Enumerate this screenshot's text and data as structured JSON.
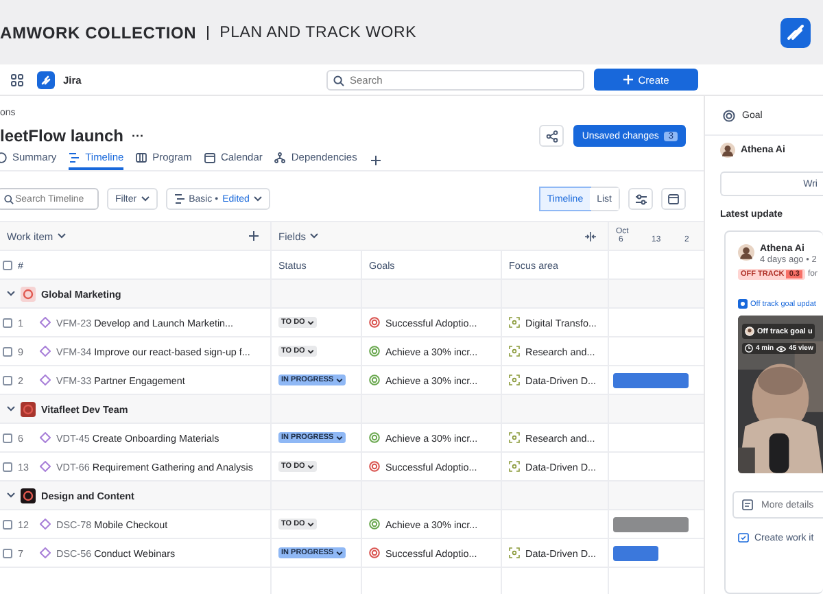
{
  "banner": {
    "title": "AMWORK COLLECTION",
    "subtitle": "PLAN AND TRACK WORK"
  },
  "nav": {
    "app": "Jira",
    "search": {
      "placeholder": "Search"
    },
    "create": "Create"
  },
  "breadcrumb": "ons",
  "title": "leetFlow launch",
  "more": "···",
  "unsaved": {
    "label": "Unsaved changes",
    "count": "3"
  },
  "tabs": [
    {
      "label": "Summary",
      "kind": "summary",
      "selected": false
    },
    {
      "label": "Timeline",
      "kind": "timeline",
      "selected": true
    },
    {
      "label": "Program",
      "kind": "program",
      "selected": false
    },
    {
      "label": "Calendar",
      "kind": "calendar",
      "selected": false
    },
    {
      "label": "Dependencies",
      "kind": "dependencies",
      "selected": false
    }
  ],
  "toolbar": {
    "search": {
      "placeholder": "Search Timeline"
    },
    "filter": "Filter",
    "view": {
      "label": "Basic",
      "separator": "•",
      "state": "Edited"
    },
    "modes": [
      {
        "label": "Timeline",
        "selected": true
      },
      {
        "label": "List",
        "selected": false
      }
    ]
  },
  "table": {
    "header": {
      "work_item": "Work item",
      "fields": "Fields",
      "month": "Oct",
      "days": [
        "6",
        "13",
        "2"
      ]
    },
    "select_all": {
      "checked": false
    },
    "columns": [
      "#",
      "Status",
      "Goals",
      "Focus area"
    ],
    "groups": [
      {
        "name": "Global Marketing",
        "color": "#f6d3d3",
        "expanded": true,
        "items": [
          {
            "number": "1",
            "key": "VFM-23",
            "title": "Develop and Launch Marketin...",
            "checked": false,
            "status": {
              "label": "TO DO",
              "kind": "todo"
            },
            "goal": {
              "label": "Successful Adoptio...",
              "color": "#d9534f"
            },
            "focus_area": "Digital Transfo..."
          },
          {
            "number": "9",
            "key": "VFM-34",
            "title": "Improve our react-based sign-up f...",
            "checked": false,
            "status": {
              "label": "TO DO",
              "kind": "todo"
            },
            "goal": {
              "label": "Achieve a 30% incr...",
              "color": "#6aa84f"
            },
            "focus_area": "Research and..."
          },
          {
            "number": "2",
            "key": "VFM-33",
            "title": "Partner Engagement",
            "checked": false,
            "status": {
              "label": "IN PROGRESS",
              "kind": "inprogress"
            },
            "goal": {
              "label": "Achieve a 30% incr...",
              "color": "#6aa84f"
            },
            "focus_area": "Data-Driven D...",
            "bar": {
              "color": "#3b78dc",
              "level": 0.89
            }
          }
        ]
      },
      {
        "name": "Vitafleet Dev Team",
        "color": "#a8352d",
        "expanded": true,
        "items": [
          {
            "number": "6",
            "key": "VDT-45",
            "title": "Create Onboarding Materials",
            "checked": false,
            "status": {
              "label": "IN PROGRESS",
              "kind": "inprogress"
            },
            "goal": {
              "label": "Achieve a 30% incr...",
              "color": "#6aa84f"
            },
            "focus_area": "Research and..."
          },
          {
            "number": "13",
            "key": "VDT-66",
            "title": "Requirement Gathering and Analysis",
            "checked": false,
            "status": {
              "label": "TO DO",
              "kind": "todo"
            },
            "goal": {
              "label": "Successful Adoptio...",
              "color": "#d9534f"
            },
            "focus_area": "Data-Driven D..."
          }
        ]
      },
      {
        "name": "Design and Content",
        "color": "#1c1416",
        "expanded": true,
        "items": [
          {
            "number": "12",
            "key": "DSC-78",
            "title": "Mobile Checkout",
            "checked": false,
            "status": {
              "label": "TO DO",
              "kind": "todo"
            },
            "goal": {
              "label": "Achieve a 30% incr...",
              "color": "#6aa84f"
            },
            "bar": {
              "color": "#8a8b8d",
              "level": 0.89
            }
          },
          {
            "number": "7",
            "key": "DSC-56",
            "title": "Conduct Webinars",
            "checked": false,
            "status": {
              "label": "IN PROGRESS",
              "kind": "inprogress"
            },
            "goal": {
              "label": "Successful Adoptio...",
              "color": "#d9534f"
            },
            "focus_area": "Data-Driven D...",
            "bar": {
              "color": "#3b78dc",
              "level": 0.53
            }
          }
        ]
      }
    ]
  },
  "panel": {
    "goal_label": "Goal",
    "owner": "Athena Ai",
    "write_button": "Wri",
    "latest_update": "Latest update",
    "update": {
      "author": "Athena Ai",
      "meta": "4 days ago • 2",
      "status": "OFF TRACK",
      "score": "0.3",
      "suffix": "for",
      "link": "Off track goal updat",
      "video": {
        "title": "Off track goal u",
        "duration": "4 min",
        "views": "45 view"
      }
    },
    "more_details": "More details",
    "create_work": "Create work it"
  }
}
